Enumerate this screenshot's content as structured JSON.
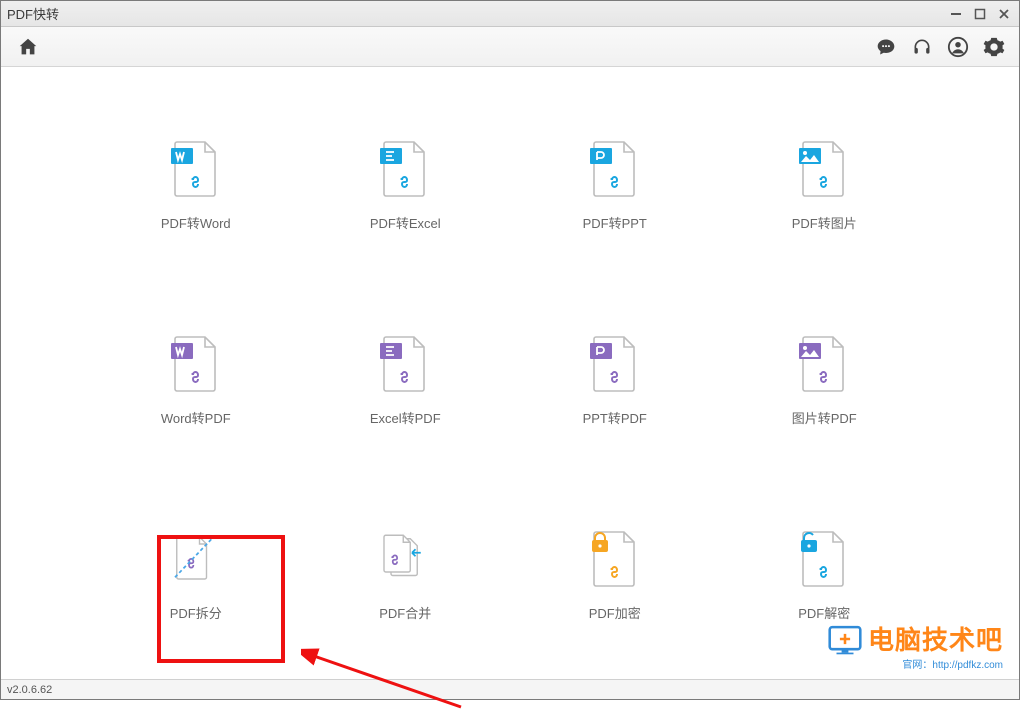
{
  "window": {
    "title": "PDF快转"
  },
  "toolbar": {
    "icons": [
      "home",
      "chat",
      "headset",
      "user",
      "settings"
    ]
  },
  "tools": [
    {
      "id": "pdf-to-word",
      "label": "PDF转Word",
      "badge_color": "#1aa6e0"
    },
    {
      "id": "pdf-to-excel",
      "label": "PDF转Excel",
      "badge_color": "#1aa6e0"
    },
    {
      "id": "pdf-to-ppt",
      "label": "PDF转PPT",
      "badge_color": "#1aa6e0"
    },
    {
      "id": "pdf-to-image",
      "label": "PDF转图片",
      "badge_color": "#1aa6e0"
    },
    {
      "id": "word-to-pdf",
      "label": "Word转PDF",
      "badge_color": "#8a6bbf"
    },
    {
      "id": "excel-to-pdf",
      "label": "Excel转PDF",
      "badge_color": "#8a6bbf"
    },
    {
      "id": "ppt-to-pdf",
      "label": "PPT转PDF",
      "badge_color": "#8a6bbf"
    },
    {
      "id": "image-to-pdf",
      "label": "图片转PDF",
      "badge_color": "#8a6bbf"
    },
    {
      "id": "pdf-split",
      "label": "PDF拆分",
      "badge_color": "#8a6bbf",
      "highlighted": true
    },
    {
      "id": "pdf-merge",
      "label": "PDF合并",
      "badge_color": "#8a6bbf"
    },
    {
      "id": "pdf-encrypt",
      "label": "PDF加密",
      "badge_color": "#f6a623"
    },
    {
      "id": "pdf-decrypt",
      "label": "PDF解密",
      "badge_color": "#1aa6e0"
    }
  ],
  "annotation": {
    "highlight_target": "pdf-split",
    "highlight_color": "#e11",
    "arrow_color": "#e11"
  },
  "watermark": {
    "text": "电脑技术吧",
    "url": "官网：http://pdfkz.com"
  },
  "status": {
    "version": "v2.0.6.62"
  }
}
